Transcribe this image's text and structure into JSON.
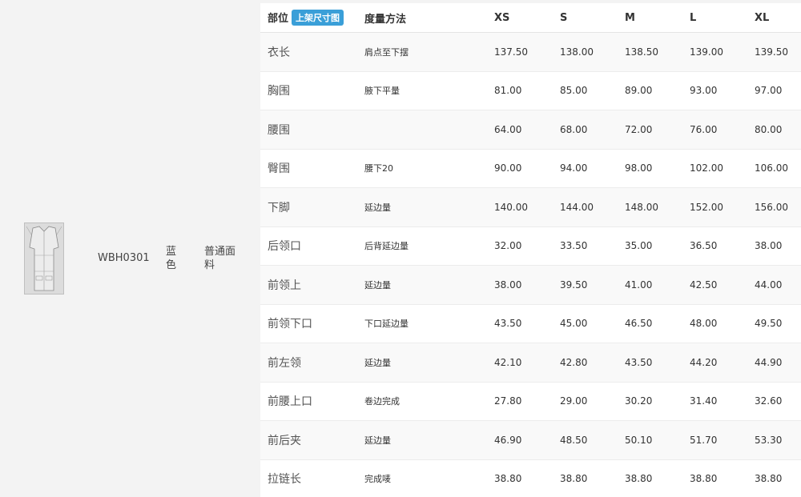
{
  "product": {
    "code": "WBH0301",
    "color": "蓝色",
    "fabric": "普通面料",
    "thumbnail_icon": "garment-sketch-thumbnail"
  },
  "size_table": {
    "headers": {
      "part": "部位",
      "tag": "上架尺寸图",
      "method": "度量方法",
      "sizes": [
        "XS",
        "S",
        "M",
        "L",
        "XL"
      ]
    },
    "rows": [
      {
        "part": "衣长",
        "method": "肩点至下摆",
        "values": [
          "137.50",
          "138.00",
          "138.50",
          "139.00",
          "139.50"
        ]
      },
      {
        "part": "胸围",
        "method": "腋下平量",
        "values": [
          "81.00",
          "85.00",
          "89.00",
          "93.00",
          "97.00"
        ]
      },
      {
        "part": "腰围",
        "method": "",
        "values": [
          "64.00",
          "68.00",
          "72.00",
          "76.00",
          "80.00"
        ]
      },
      {
        "part": "臀围",
        "method": "腰下20",
        "values": [
          "90.00",
          "94.00",
          "98.00",
          "102.00",
          "106.00"
        ]
      },
      {
        "part": "下脚",
        "method": "延边量",
        "values": [
          "140.00",
          "144.00",
          "148.00",
          "152.00",
          "156.00"
        ]
      },
      {
        "part": "后领口",
        "method": "后背延边量",
        "values": [
          "32.00",
          "33.50",
          "35.00",
          "36.50",
          "38.00"
        ]
      },
      {
        "part": "前领上",
        "method": "延边量",
        "values": [
          "38.00",
          "39.50",
          "41.00",
          "42.50",
          "44.00"
        ]
      },
      {
        "part": "前领下口",
        "method": "下口延边量",
        "values": [
          "43.50",
          "45.00",
          "46.50",
          "48.00",
          "49.50"
        ]
      },
      {
        "part": "前左领",
        "method": "延边量",
        "values": [
          "42.10",
          "42.80",
          "43.50",
          "44.20",
          "44.90"
        ]
      },
      {
        "part": "前腰上口",
        "method": "卷边完成",
        "values": [
          "27.80",
          "29.00",
          "30.20",
          "31.40",
          "32.60"
        ]
      },
      {
        "part": "前后夹",
        "method": "延边量",
        "values": [
          "46.90",
          "48.50",
          "50.10",
          "51.70",
          "53.30"
        ]
      },
      {
        "part": "拉链长",
        "method": "完成唛",
        "values": [
          "38.80",
          "38.80",
          "38.80",
          "38.80",
          "38.80"
        ]
      }
    ]
  }
}
